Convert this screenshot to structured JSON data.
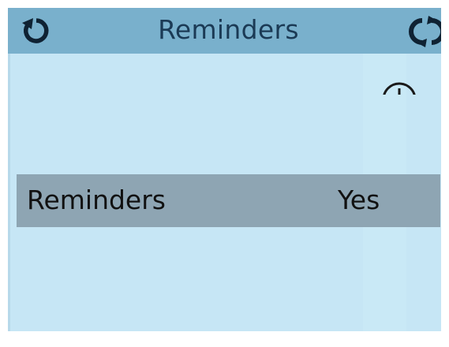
{
  "header": {
    "title": "Reminders",
    "left_icon": "back-arrow-icon",
    "right_icon": "refresh-cycle-icon"
  },
  "settings": [
    {
      "label": "Reminders",
      "value": "Yes"
    }
  ],
  "colors": {
    "header_bg": "#79b0cc",
    "screen_bg": "#c6e6f5",
    "selected_row_bg": "#8ea5b3",
    "text": "#111111",
    "header_text": "#1b3a55"
  }
}
